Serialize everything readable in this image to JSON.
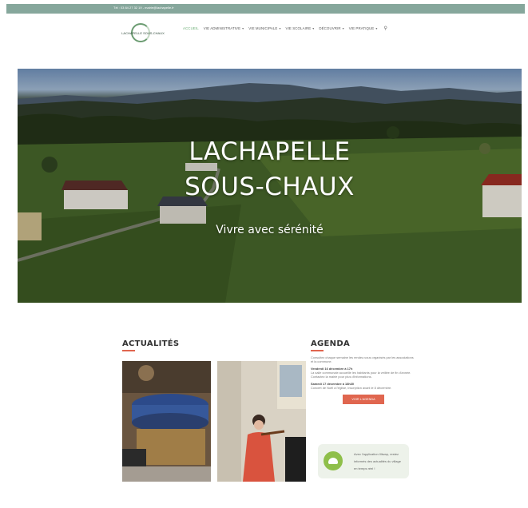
{
  "colors": {
    "topbar": "#86a79c",
    "accent_green": "#6cae76",
    "accent_red": "#e0664f"
  },
  "topbar": {
    "contact": "Tél : 03 84 27 32 19 - mairie@lachapelle.fr"
  },
  "logo": {
    "text": "LACHAPELLE SOUS-CHAUX",
    "icon": "village-logo"
  },
  "nav": {
    "items": [
      {
        "label": "ACCUEIL",
        "dropdown": false
      },
      {
        "label": "VIE ADMINISTRATIVE",
        "dropdown": true
      },
      {
        "label": "VIE MUNICIPALE",
        "dropdown": true
      },
      {
        "label": "VIE SCOLAIRE",
        "dropdown": true
      },
      {
        "label": "DÉCOUVRIR",
        "dropdown": true
      },
      {
        "label": "VIE PRATIQUE",
        "dropdown": true
      }
    ],
    "search_icon": "search-icon"
  },
  "hero": {
    "title_line1": "LACHAPELLE",
    "title_line2": "SOUS-CHAUX",
    "subtitle": "Vivre avec sérénité"
  },
  "news": {
    "heading": "ACTUALITÉS"
  },
  "agenda": {
    "heading": "AGENDA",
    "intro": "Consultez chaque semaine les rendez-vous organisés par les associations et la commune.",
    "event1_title": "Vendredi 16 décembre à 17h",
    "event1_text": "La salle communale accueille les habitants pour la veillée de fin d'année. Contactez la mairie pour plus d'informations.",
    "event2_title": "Samedi 17 décembre à 18h30",
    "event2_text": "Concert de Noël à l'église, inscription avant le 8 décembre.",
    "button": "VOIR L'AGENDA"
  },
  "app_card": {
    "text": "Avec l'application Illiwap, restez informés des actualités du village en temps réel !"
  }
}
